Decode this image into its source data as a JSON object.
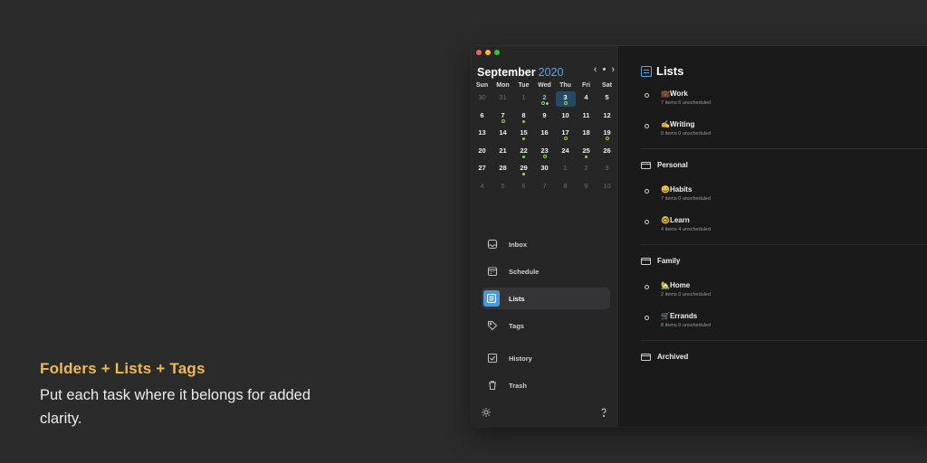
{
  "promo": {
    "title": "Folders + Lists + Tags",
    "body": "Put each task where it belongs for added clarity."
  },
  "calendar": {
    "month": "September",
    "year": "2020",
    "nav": {
      "prev": "‹",
      "today": "•",
      "next": "›"
    },
    "weekdays": [
      "Sun",
      "Mon",
      "Tue",
      "Wed",
      "Thu",
      "Fri",
      "Sat"
    ],
    "days": [
      {
        "d": "30",
        "muted": true
      },
      {
        "d": "31",
        "muted": true
      },
      {
        "d": "1",
        "muted": true
      },
      {
        "d": "2",
        "today": true,
        "dots": [
          "ring",
          "g"
        ]
      },
      {
        "d": "3",
        "selected": true,
        "dots": [
          "ring"
        ]
      },
      {
        "d": "4"
      },
      {
        "d": "5"
      },
      {
        "d": "6"
      },
      {
        "d": "7",
        "dots": [
          "ring"
        ]
      },
      {
        "d": "8",
        "dots": [
          "g"
        ]
      },
      {
        "d": "9"
      },
      {
        "d": "10"
      },
      {
        "d": "11"
      },
      {
        "d": "12"
      },
      {
        "d": "13"
      },
      {
        "d": "14"
      },
      {
        "d": "15",
        "dots": [
          "g"
        ]
      },
      {
        "d": "16"
      },
      {
        "d": "17",
        "dots": [
          "ring"
        ]
      },
      {
        "d": "18"
      },
      {
        "d": "19",
        "dots": [
          "ring"
        ]
      },
      {
        "d": "20"
      },
      {
        "d": "21"
      },
      {
        "d": "22",
        "dots": [
          "g"
        ]
      },
      {
        "d": "23",
        "dots": [
          "ring"
        ]
      },
      {
        "d": "24"
      },
      {
        "d": "25",
        "dots": [
          "g"
        ]
      },
      {
        "d": "26"
      },
      {
        "d": "27"
      },
      {
        "d": "28"
      },
      {
        "d": "29",
        "dots": [
          "y"
        ]
      },
      {
        "d": "30"
      },
      {
        "d": "1",
        "muted": true
      },
      {
        "d": "2",
        "muted": true
      },
      {
        "d": "3",
        "muted": true
      },
      {
        "d": "4",
        "muted": true
      },
      {
        "d": "5",
        "muted": true
      },
      {
        "d": "6",
        "muted": true
      },
      {
        "d": "7",
        "muted": true
      },
      {
        "d": "8",
        "muted": true
      },
      {
        "d": "9",
        "muted": true
      },
      {
        "d": "10",
        "muted": true
      }
    ]
  },
  "nav": {
    "inbox": "Inbox",
    "schedule": "Schedule",
    "lists": "Lists",
    "tags": "Tags",
    "history": "History",
    "trash": "Trash"
  },
  "main": {
    "title": "Lists",
    "lists": {
      "work": {
        "name": "💼Work",
        "meta": "7 items  6 unscheduled"
      },
      "writing": {
        "name": "✍️Writing",
        "meta": "0 items  0 unscheduled"
      },
      "habits": {
        "name": "😀Habits",
        "meta": "7 items  0 unscheduled"
      },
      "learn": {
        "name": "🤓Learn",
        "meta": "4 items  4 unscheduled"
      },
      "home": {
        "name": "🏡Home",
        "meta": "2 items  0 unscheduled"
      },
      "errands": {
        "name": "🛒Errands",
        "meta": "8 items  0 unscheduled"
      }
    },
    "folders": {
      "personal": "Personal",
      "family": "Family",
      "archived": "Archived"
    }
  }
}
